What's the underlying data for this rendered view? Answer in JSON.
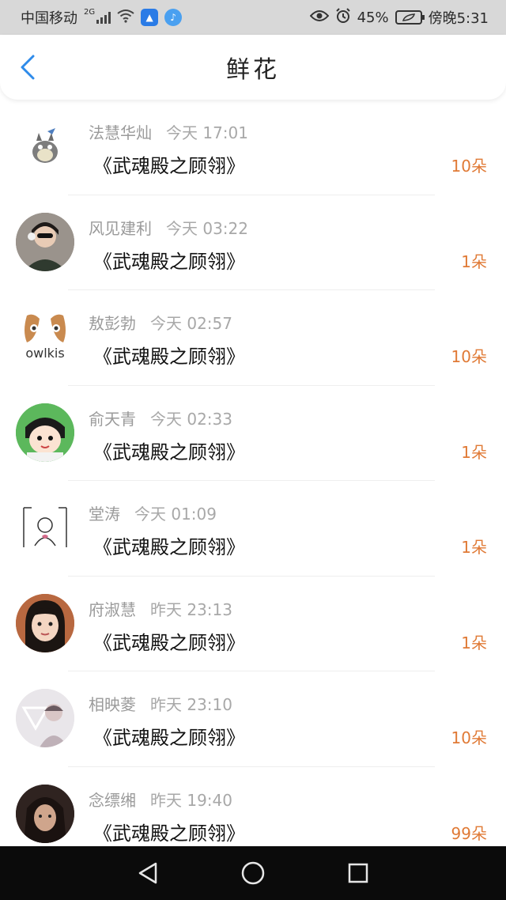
{
  "status_bar": {
    "carrier": "中国移动",
    "network": "2G",
    "battery_percent": "45%",
    "time": "傍晚5:31"
  },
  "header": {
    "title": "鲜花"
  },
  "items": [
    {
      "sender": "法慧华灿",
      "time": "今天 17:01",
      "title": "《武魂殿之顾翎》",
      "quantity": "10朵"
    },
    {
      "sender": "风见建利",
      "time": "今天 03:22",
      "title": "《武魂殿之顾翎》",
      "quantity": "1朵"
    },
    {
      "sender": "敖彭勃",
      "time": "今天 02:57",
      "title": "《武魂殿之顾翎》",
      "quantity": "10朵",
      "avatar_text": "owlkis"
    },
    {
      "sender": "俞天青",
      "time": "今天 02:33",
      "title": "《武魂殿之顾翎》",
      "quantity": "1朵"
    },
    {
      "sender": "堂涛",
      "time": "今天 01:09",
      "title": "《武魂殿之顾翎》",
      "quantity": "1朵"
    },
    {
      "sender": "府淑慧",
      "time": "昨天 23:13",
      "title": "《武魂殿之顾翎》",
      "quantity": "1朵"
    },
    {
      "sender": "相映菱",
      "time": "昨天 23:10",
      "title": "《武魂殿之顾翎》",
      "quantity": "10朵"
    },
    {
      "sender": "念缥缃",
      "time": "昨天 19:40",
      "title": "《武魂殿之顾翎》",
      "quantity": "99朵"
    }
  ],
  "colors": {
    "accent_blue": "#2e8bea",
    "quantity_orange": "#e07a36",
    "status_bar_bg": "#d8d8d8",
    "nav_bar_bg": "#0b0b0b"
  }
}
